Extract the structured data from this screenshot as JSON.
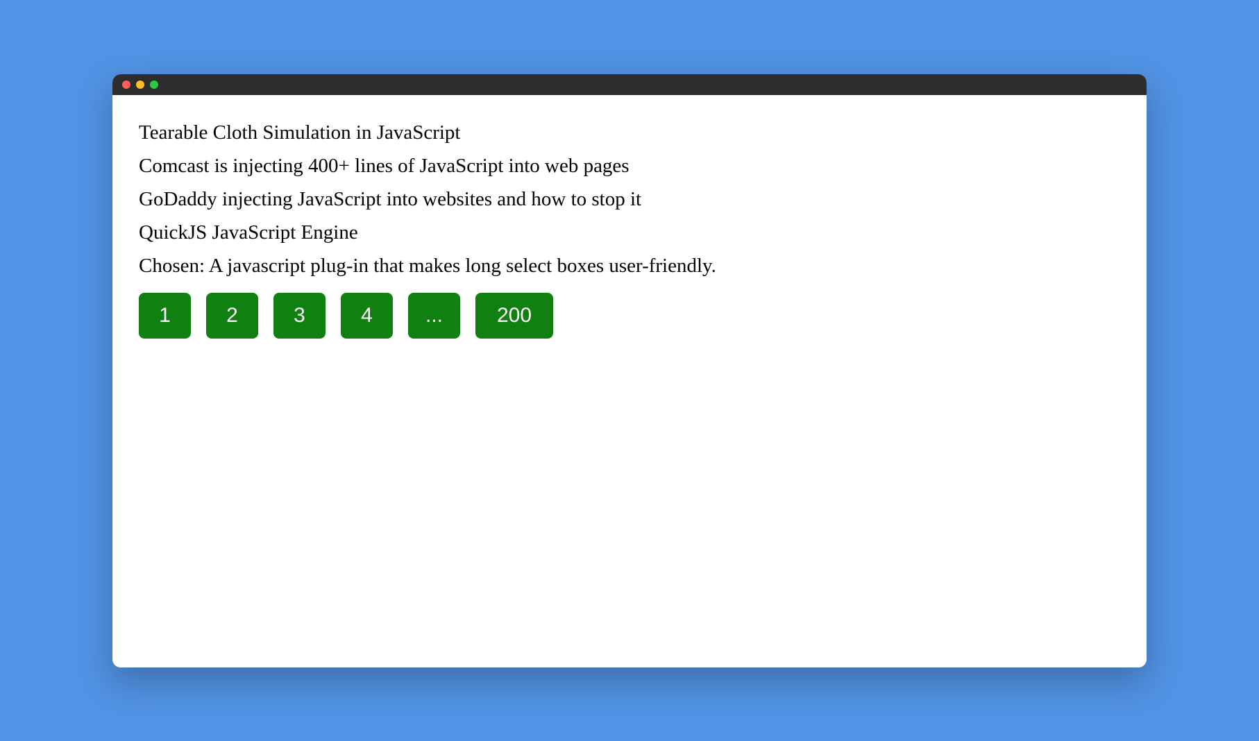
{
  "list": {
    "items": [
      "Tearable Cloth Simulation in JavaScript",
      "Comcast is injecting 400+ lines of JavaScript into web pages",
      "GoDaddy injecting JavaScript into websites and how to stop it",
      "QuickJS JavaScript Engine",
      "Chosen: A javascript plug-in that makes long select boxes user-friendly."
    ]
  },
  "pagination": {
    "pages": [
      "1",
      "2",
      "3",
      "4",
      "...",
      "200"
    ]
  }
}
